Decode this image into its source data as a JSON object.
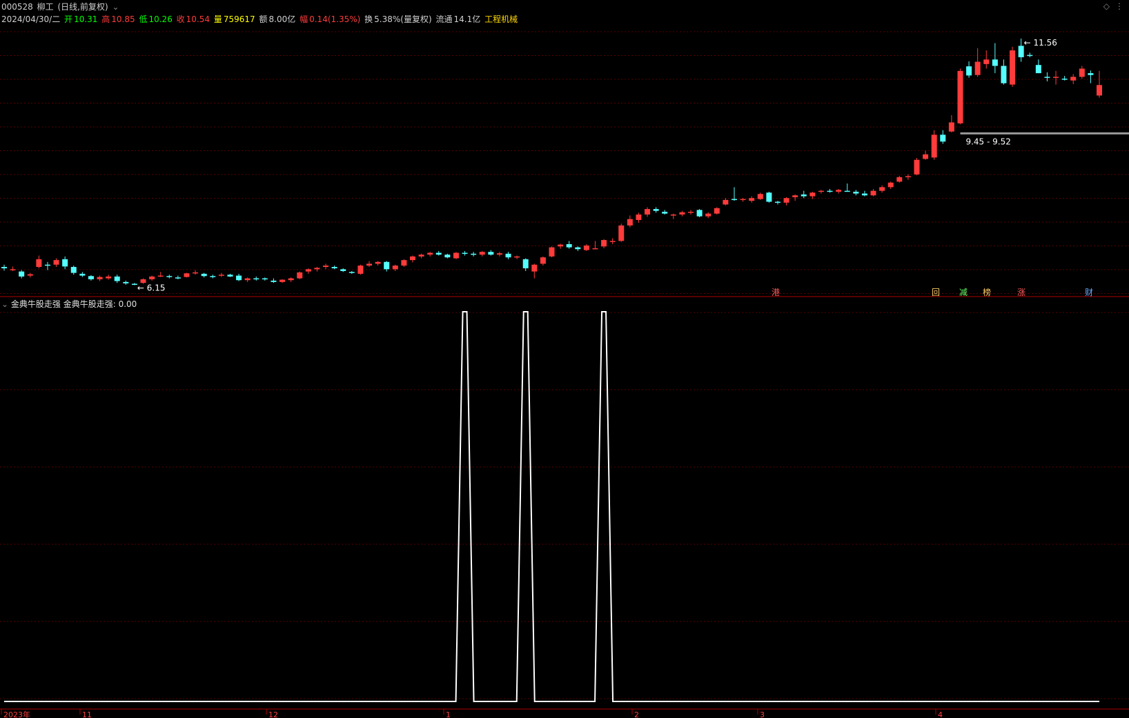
{
  "header": {
    "row1": {
      "code": "000528",
      "name": "柳工",
      "mode": "(日线,前复权)"
    },
    "row2": {
      "date": "2024/04/30/二",
      "open_label": "开",
      "open": "10.31",
      "high_label": "高",
      "high": "10.85",
      "low_label": "低",
      "low": "10.26",
      "close_label": "收",
      "close": "10.54",
      "vol_label": "量",
      "vol": "759617",
      "amt_label": "额",
      "amt": "8.00亿",
      "chg_label": "幅",
      "chg": "0.14(1.35%)",
      "turn_label": "换",
      "turn": "5.38%(量复权)",
      "float_label": "流通",
      "float": "14.1亿",
      "industry": "工程机械"
    }
  },
  "indicator": {
    "name": "金典牛股走强",
    "value_label": "金典牛股走强: 0.00"
  },
  "annotations": {
    "high_mark": "11.56",
    "low_mark": "6.15",
    "range_mark": "9.45 - 9.52"
  },
  "event_tags": [
    "港",
    "回",
    "减",
    "榜",
    "涨",
    "财"
  ],
  "time_axis": [
    "2023年",
    "11",
    "12",
    "1",
    "2",
    "3",
    "4"
  ],
  "colors": {
    "up": "#ff3b3b",
    "down": "#54ffff",
    "grid": "#5a0000",
    "divider": "#b00000",
    "indicator_line": "#ffffff"
  },
  "chart_data": {
    "type": "candlestick",
    "title": "",
    "ylabel": "",
    "yrange": [
      5.9,
      11.8
    ],
    "candles": [
      [
        6.55,
        6.6,
        6.47,
        6.52
      ],
      [
        6.5,
        6.56,
        6.46,
        6.5
      ],
      [
        6.45,
        6.48,
        6.3,
        6.34
      ],
      [
        6.36,
        6.42,
        6.32,
        6.39
      ],
      [
        6.55,
        6.8,
        6.52,
        6.72
      ],
      [
        6.6,
        6.66,
        6.48,
        6.58
      ],
      [
        6.6,
        6.74,
        6.55,
        6.7
      ],
      [
        6.72,
        6.78,
        6.5,
        6.56
      ],
      [
        6.55,
        6.58,
        6.38,
        6.42
      ],
      [
        6.4,
        6.44,
        6.33,
        6.36
      ],
      [
        6.35,
        6.37,
        6.25,
        6.28
      ],
      [
        6.28,
        6.36,
        6.24,
        6.33
      ],
      [
        6.3,
        6.38,
        6.27,
        6.34
      ],
      [
        6.34,
        6.38,
        6.2,
        6.24
      ],
      [
        6.22,
        6.25,
        6.16,
        6.19
      ],
      [
        6.18,
        6.2,
        6.15,
        6.17
      ],
      [
        6.2,
        6.3,
        6.18,
        6.28
      ],
      [
        6.28,
        6.36,
        6.25,
        6.34
      ],
      [
        6.35,
        6.44,
        6.33,
        6.36
      ],
      [
        6.35,
        6.38,
        6.3,
        6.33
      ],
      [
        6.32,
        6.36,
        6.28,
        6.3
      ],
      [
        6.33,
        6.42,
        6.32,
        6.41
      ],
      [
        6.42,
        6.48,
        6.38,
        6.43
      ],
      [
        6.4,
        6.42,
        6.32,
        6.35
      ],
      [
        6.35,
        6.38,
        6.3,
        6.33
      ],
      [
        6.36,
        6.42,
        6.33,
        6.38
      ],
      [
        6.38,
        6.4,
        6.33,
        6.34
      ],
      [
        6.36,
        6.4,
        6.24,
        6.26
      ],
      [
        6.26,
        6.32,
        6.22,
        6.3
      ],
      [
        6.3,
        6.34,
        6.25,
        6.28
      ],
      [
        6.3,
        6.32,
        6.25,
        6.29
      ],
      [
        6.25,
        6.3,
        6.2,
        6.22
      ],
      [
        6.22,
        6.28,
        6.2,
        6.27
      ],
      [
        6.26,
        6.32,
        6.22,
        6.3
      ],
      [
        6.3,
        6.45,
        6.28,
        6.43
      ],
      [
        6.45,
        6.52,
        6.4,
        6.5
      ],
      [
        6.5,
        6.55,
        6.45,
        6.53
      ],
      [
        6.55,
        6.62,
        6.5,
        6.58
      ],
      [
        6.55,
        6.58,
        6.5,
        6.52
      ],
      [
        6.5,
        6.52,
        6.44,
        6.46
      ],
      [
        6.44,
        6.46,
        6.4,
        6.43
      ],
      [
        6.4,
        6.6,
        6.38,
        6.58
      ],
      [
        6.58,
        6.68,
        6.55,
        6.62
      ],
      [
        6.62,
        6.68,
        6.58,
        6.66
      ],
      [
        6.66,
        6.68,
        6.45,
        6.5
      ],
      [
        6.5,
        6.6,
        6.46,
        6.58
      ],
      [
        6.58,
        6.72,
        6.55,
        6.7
      ],
      [
        6.7,
        6.8,
        6.65,
        6.78
      ],
      [
        6.78,
        6.84,
        6.74,
        6.82
      ],
      [
        6.82,
        6.88,
        6.78,
        6.86
      ],
      [
        6.86,
        6.9,
        6.8,
        6.82
      ],
      [
        6.82,
        6.84,
        6.74,
        6.76
      ],
      [
        6.74,
        6.88,
        6.72,
        6.86
      ],
      [
        6.86,
        6.9,
        6.8,
        6.84
      ],
      [
        6.84,
        6.88,
        6.78,
        6.82
      ],
      [
        6.82,
        6.9,
        6.78,
        6.88
      ],
      [
        6.88,
        6.92,
        6.8,
        6.82
      ],
      [
        6.82,
        6.88,
        6.78,
        6.85
      ],
      [
        6.84,
        6.88,
        6.72,
        6.76
      ],
      [
        6.76,
        6.8,
        6.72,
        6.78
      ],
      [
        6.72,
        6.74,
        6.46,
        6.52
      ],
      [
        6.45,
        6.62,
        6.3,
        6.6
      ],
      [
        6.62,
        6.78,
        6.58,
        6.76
      ],
      [
        6.78,
        7.0,
        6.76,
        6.98
      ],
      [
        7.0,
        7.06,
        6.95,
        7.04
      ],
      [
        7.05,
        7.12,
        6.95,
        6.98
      ],
      [
        6.98,
        7.0,
        6.9,
        6.94
      ],
      [
        6.92,
        7.05,
        6.9,
        7.02
      ],
      [
        6.96,
        7.12,
        6.94,
        6.96
      ],
      [
        7.0,
        7.16,
        6.96,
        7.14
      ],
      [
        7.1,
        7.18,
        7.05,
        7.12
      ],
      [
        7.12,
        7.5,
        7.1,
        7.46
      ],
      [
        7.46,
        7.68,
        7.42,
        7.6
      ],
      [
        7.58,
        7.74,
        7.52,
        7.7
      ],
      [
        7.7,
        7.86,
        7.65,
        7.82
      ],
      [
        7.82,
        7.86,
        7.74,
        7.78
      ],
      [
        7.76,
        7.8,
        7.7,
        7.72
      ],
      [
        7.68,
        7.72,
        7.6,
        7.7
      ],
      [
        7.7,
        7.78,
        7.66,
        7.75
      ],
      [
        7.75,
        7.8,
        7.7,
        7.76
      ],
      [
        7.8,
        7.82,
        7.64,
        7.66
      ],
      [
        7.66,
        7.75,
        7.62,
        7.72
      ],
      [
        7.72,
        7.86,
        7.7,
        7.84
      ],
      [
        7.92,
        8.06,
        7.9,
        8.02
      ],
      [
        8.04,
        8.3,
        8.0,
        8.02
      ],
      [
        8.02,
        8.06,
        7.98,
        8.04
      ],
      [
        8.0,
        8.1,
        7.96,
        8.06
      ],
      [
        8.04,
        8.18,
        8.02,
        8.15
      ],
      [
        8.18,
        8.2,
        7.96,
        7.98
      ],
      [
        7.98,
        8.0,
        7.92,
        7.96
      ],
      [
        7.96,
        8.08,
        7.9,
        8.06
      ],
      [
        8.08,
        8.14,
        8.0,
        8.12
      ],
      [
        8.14,
        8.22,
        8.06,
        8.1
      ],
      [
        8.1,
        8.2,
        8.04,
        8.18
      ],
      [
        8.2,
        8.24,
        8.16,
        8.22
      ],
      [
        8.22,
        8.26,
        8.18,
        8.2
      ],
      [
        8.2,
        8.26,
        8.16,
        8.24
      ],
      [
        8.22,
        8.38,
        8.2,
        8.2
      ],
      [
        8.2,
        8.24,
        8.12,
        8.16
      ],
      [
        8.16,
        8.22,
        8.1,
        8.12
      ],
      [
        8.12,
        8.26,
        8.1,
        8.22
      ],
      [
        8.22,
        8.34,
        8.18,
        8.3
      ],
      [
        8.3,
        8.42,
        8.26,
        8.4
      ],
      [
        8.42,
        8.55,
        8.4,
        8.52
      ],
      [
        8.52,
        8.58,
        8.46,
        8.54
      ],
      [
        8.58,
        8.94,
        8.56,
        8.9
      ],
      [
        8.92,
        9.1,
        8.9,
        9.02
      ],
      [
        8.95,
        9.55,
        8.9,
        9.45
      ],
      [
        9.45,
        9.55,
        9.25,
        9.3
      ],
      [
        9.52,
        9.88,
        9.5,
        9.72
      ],
      [
        9.7,
        10.9,
        9.68,
        10.85
      ],
      [
        10.95,
        11.06,
        10.7,
        10.75
      ],
      [
        10.76,
        11.35,
        10.72,
        11.05
      ],
      [
        11.0,
        11.3,
        10.9,
        11.1
      ],
      [
        11.1,
        11.46,
        10.8,
        10.96
      ],
      [
        10.96,
        11.1,
        10.55,
        10.58
      ],
      [
        10.55,
        11.38,
        10.5,
        11.3
      ],
      [
        11.4,
        11.56,
        11.05,
        11.15
      ],
      [
        11.2,
        11.25,
        11.15,
        11.18
      ],
      [
        10.98,
        11.1,
        10.8,
        10.8
      ],
      [
        10.72,
        10.82,
        10.62,
        10.7
      ],
      [
        10.7,
        10.85,
        10.55,
        10.72
      ],
      [
        10.68,
        10.74,
        10.64,
        10.66
      ],
      [
        10.64,
        10.78,
        10.56,
        10.72
      ],
      [
        10.72,
        10.96,
        10.68,
        10.9
      ],
      [
        10.8,
        10.86,
        10.58,
        10.76
      ],
      [
        10.31,
        10.85,
        10.26,
        10.54
      ]
    ],
    "indicator_series": {
      "name": "金典牛股走强",
      "yrange": [
        0,
        1
      ],
      "spikes_at_candle_index": [
        53,
        60,
        69
      ]
    }
  }
}
